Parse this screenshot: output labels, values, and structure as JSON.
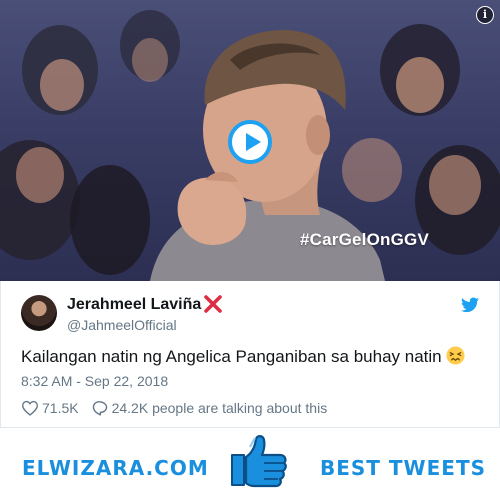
{
  "video": {
    "hashtag": "#CarGelOnGGV",
    "info_icon": "info-icon",
    "play_icon": "play-icon"
  },
  "tweet": {
    "user_name": "Jerahmeel Laviña",
    "user_handle": "@JahmeelOfficial",
    "text": "Kailangan natin ng Angelica Panganiban sa buhay natin",
    "emoji": "confounded-face-emoji",
    "timestamp": "8:32 AM - Sep 22, 2018",
    "likes": "71.5K",
    "replies_text": "24.2K people are talking about this"
  },
  "banner": {
    "site_name": "ELWIZARA.COM",
    "label": "BEST TWEETS"
  },
  "colors": {
    "twitter_blue": "#1da1f2",
    "banner_blue": "#1a8fdd",
    "cross_red": "#dd2e44",
    "secondary_text": "#657786"
  }
}
